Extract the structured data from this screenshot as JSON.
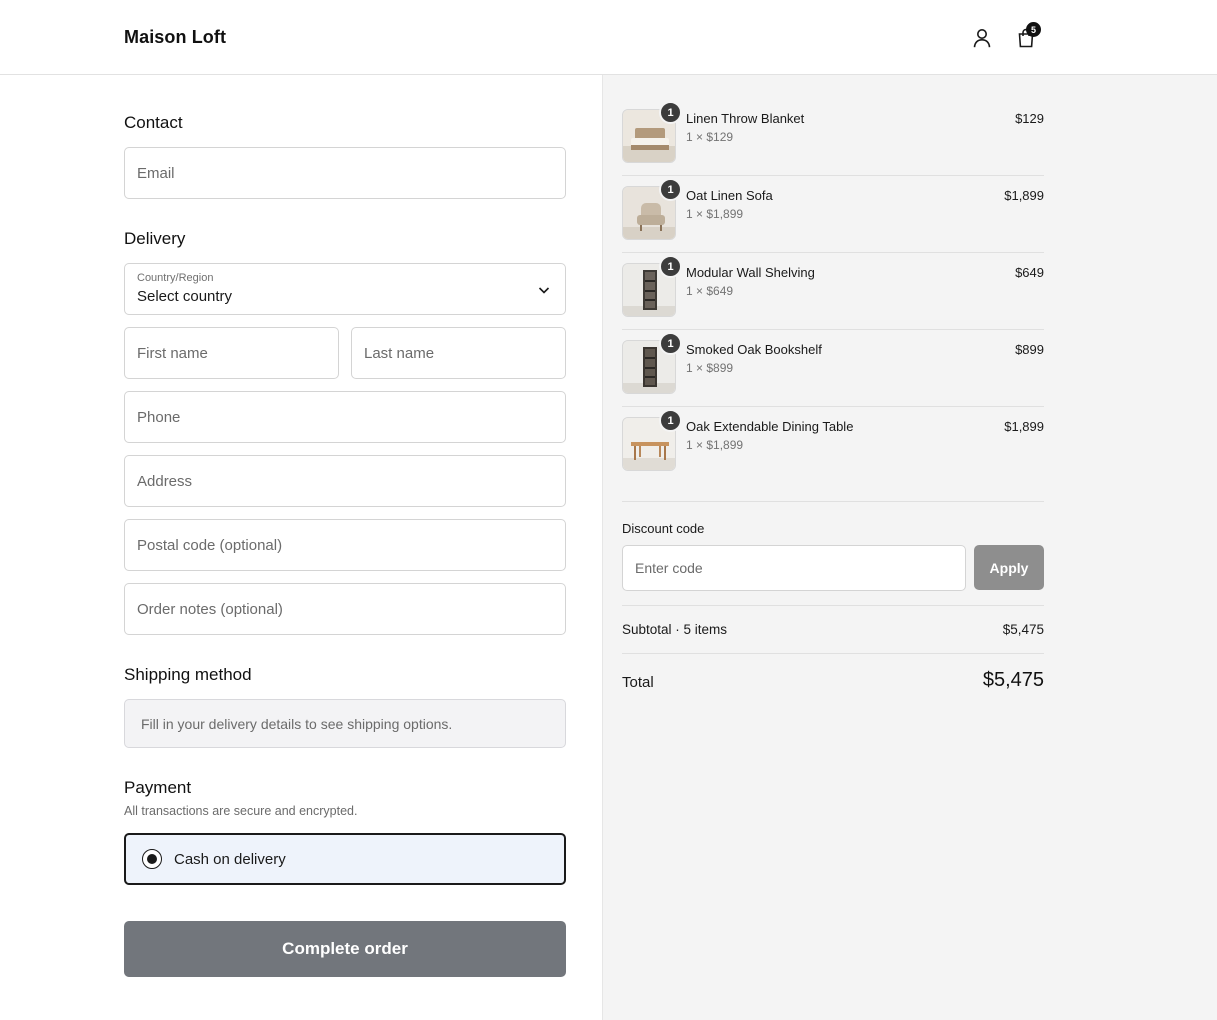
{
  "header": {
    "brand": "Maison Loft",
    "cart_count": "5"
  },
  "contact": {
    "title": "Contact",
    "email_placeholder": "Email"
  },
  "delivery": {
    "title": "Delivery",
    "country_label": "Country/Region",
    "country_value": "Select country",
    "first_name_placeholder": "First name",
    "last_name_placeholder": "Last name",
    "phone_placeholder": "Phone",
    "address_placeholder": "Address",
    "postal_placeholder": "Postal code (optional)",
    "notes_placeholder": "Order notes (optional)"
  },
  "shipping": {
    "title": "Shipping method",
    "message": "Fill in your delivery details to see shipping options."
  },
  "payment": {
    "title": "Payment",
    "subtitle": "All transactions are secure and encrypted.",
    "option_label": "Cash on delivery",
    "selected": true
  },
  "complete_button": "Complete order",
  "summary": {
    "items": [
      {
        "name": "Linen Throw Blanket",
        "unit": "1 × $129",
        "price": "$129",
        "qty": "1",
        "icon": "bed-image"
      },
      {
        "name": "Oat Linen Sofa",
        "unit": "1 × $1,899",
        "price": "$1,899",
        "qty": "1",
        "icon": "armchair-image"
      },
      {
        "name": "Modular Wall Shelving",
        "unit": "1 × $649",
        "price": "$649",
        "qty": "1",
        "icon": "shelf-image"
      },
      {
        "name": "Smoked Oak Bookshelf",
        "unit": "1 × $899",
        "price": "$899",
        "qty": "1",
        "icon": "bookshelf-image"
      },
      {
        "name": "Oak Extendable Dining Table",
        "unit": "1 × $1,899",
        "price": "$1,899",
        "qty": "1",
        "icon": "table-image"
      }
    ],
    "discount_label": "Discount code",
    "discount_placeholder": "Enter code",
    "apply_label": "Apply",
    "subtotal_label": "Subtotal · 5 items",
    "subtotal_value": "$5,475",
    "total_label": "Total",
    "total_value": "$5,475"
  },
  "colors": {
    "accent": "#1a1a1a",
    "panel_bg": "#f4f4f4",
    "button_disabled": "#72767c",
    "payment_selected_bg": "#eef3fb"
  }
}
